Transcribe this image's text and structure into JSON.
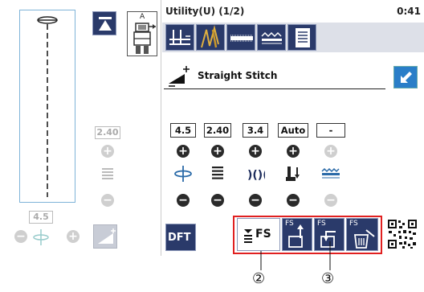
{
  "header": {
    "title": "Utility(U) (1/2)",
    "time": "0:41"
  },
  "left_panel": {
    "pedal_label": "A",
    "length_value": "2.40",
    "width_value": "4.5"
  },
  "stitch": {
    "name": "Straight Stitch"
  },
  "settings": {
    "values": [
      "4.5",
      "2.40",
      "3.4",
      "Auto",
      "-"
    ]
  },
  "bottom": {
    "dft_label": "DFT",
    "fs_label": "FS",
    "fs_small": "FS",
    "callout_2": "②",
    "callout_3": "③"
  },
  "colors": {
    "accent": "#2a3a6a",
    "callout": "#e02020"
  }
}
